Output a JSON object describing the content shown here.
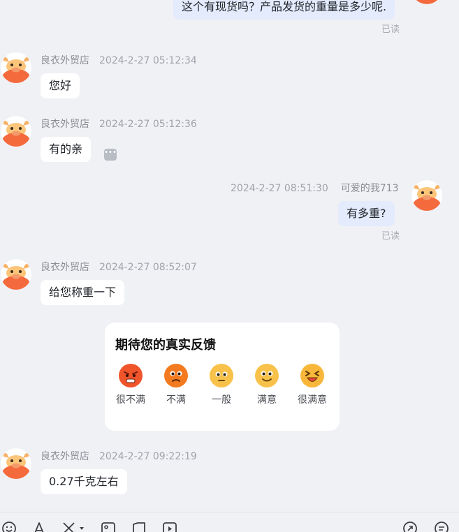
{
  "messages": [
    {
      "id": "m0",
      "direction": "out",
      "text": "这个有现货吗？产品发货的重量是多少呢.",
      "status": "已读"
    },
    {
      "id": "m1",
      "direction": "in",
      "sender": "良衣外贸店",
      "time": "2024-2-27 05:12:34",
      "text": "您好"
    },
    {
      "id": "m2",
      "direction": "in",
      "sender": "良衣外贸店",
      "time": "2024-2-27 05:12:36",
      "text": "有的亲"
    },
    {
      "id": "m3",
      "direction": "out",
      "sender": "可爱的我713",
      "time": "2024-2-27 08:51:30",
      "text": "有多重?",
      "status": "已读"
    },
    {
      "id": "m4",
      "direction": "in",
      "sender": "良衣外贸店",
      "time": "2024-2-27 08:52:07",
      "text": "给您称重一下"
    },
    {
      "id": "m5",
      "direction": "in",
      "sender": "良衣外贸店",
      "time": "2024-2-27 09:22:19",
      "text": "0.27千克左右"
    }
  ],
  "feedback": {
    "title": "期待您的真实反馈",
    "options": [
      {
        "label": "很不满",
        "icon": "angry-face-icon"
      },
      {
        "label": "不满",
        "icon": "frowning-face-icon"
      },
      {
        "label": "一般",
        "icon": "neutral-face-icon"
      },
      {
        "label": "满意",
        "icon": "smiling-face-icon"
      },
      {
        "label": "很满意",
        "icon": "laughing-face-icon"
      }
    ]
  },
  "toolbar": {
    "icons": [
      "emoji-icon",
      "font-icon",
      "scissors-icon",
      "image-icon",
      "folder-icon",
      "video-icon",
      "send-icon",
      "quick-reply-icon"
    ]
  },
  "colors": {
    "background": "#f0f1f5",
    "incoming_bubble": "#ffffff",
    "outgoing_bubble": "#e3ebfc",
    "meta_text": "#a0a3aa",
    "avatar_bg": "#f56a3d"
  }
}
